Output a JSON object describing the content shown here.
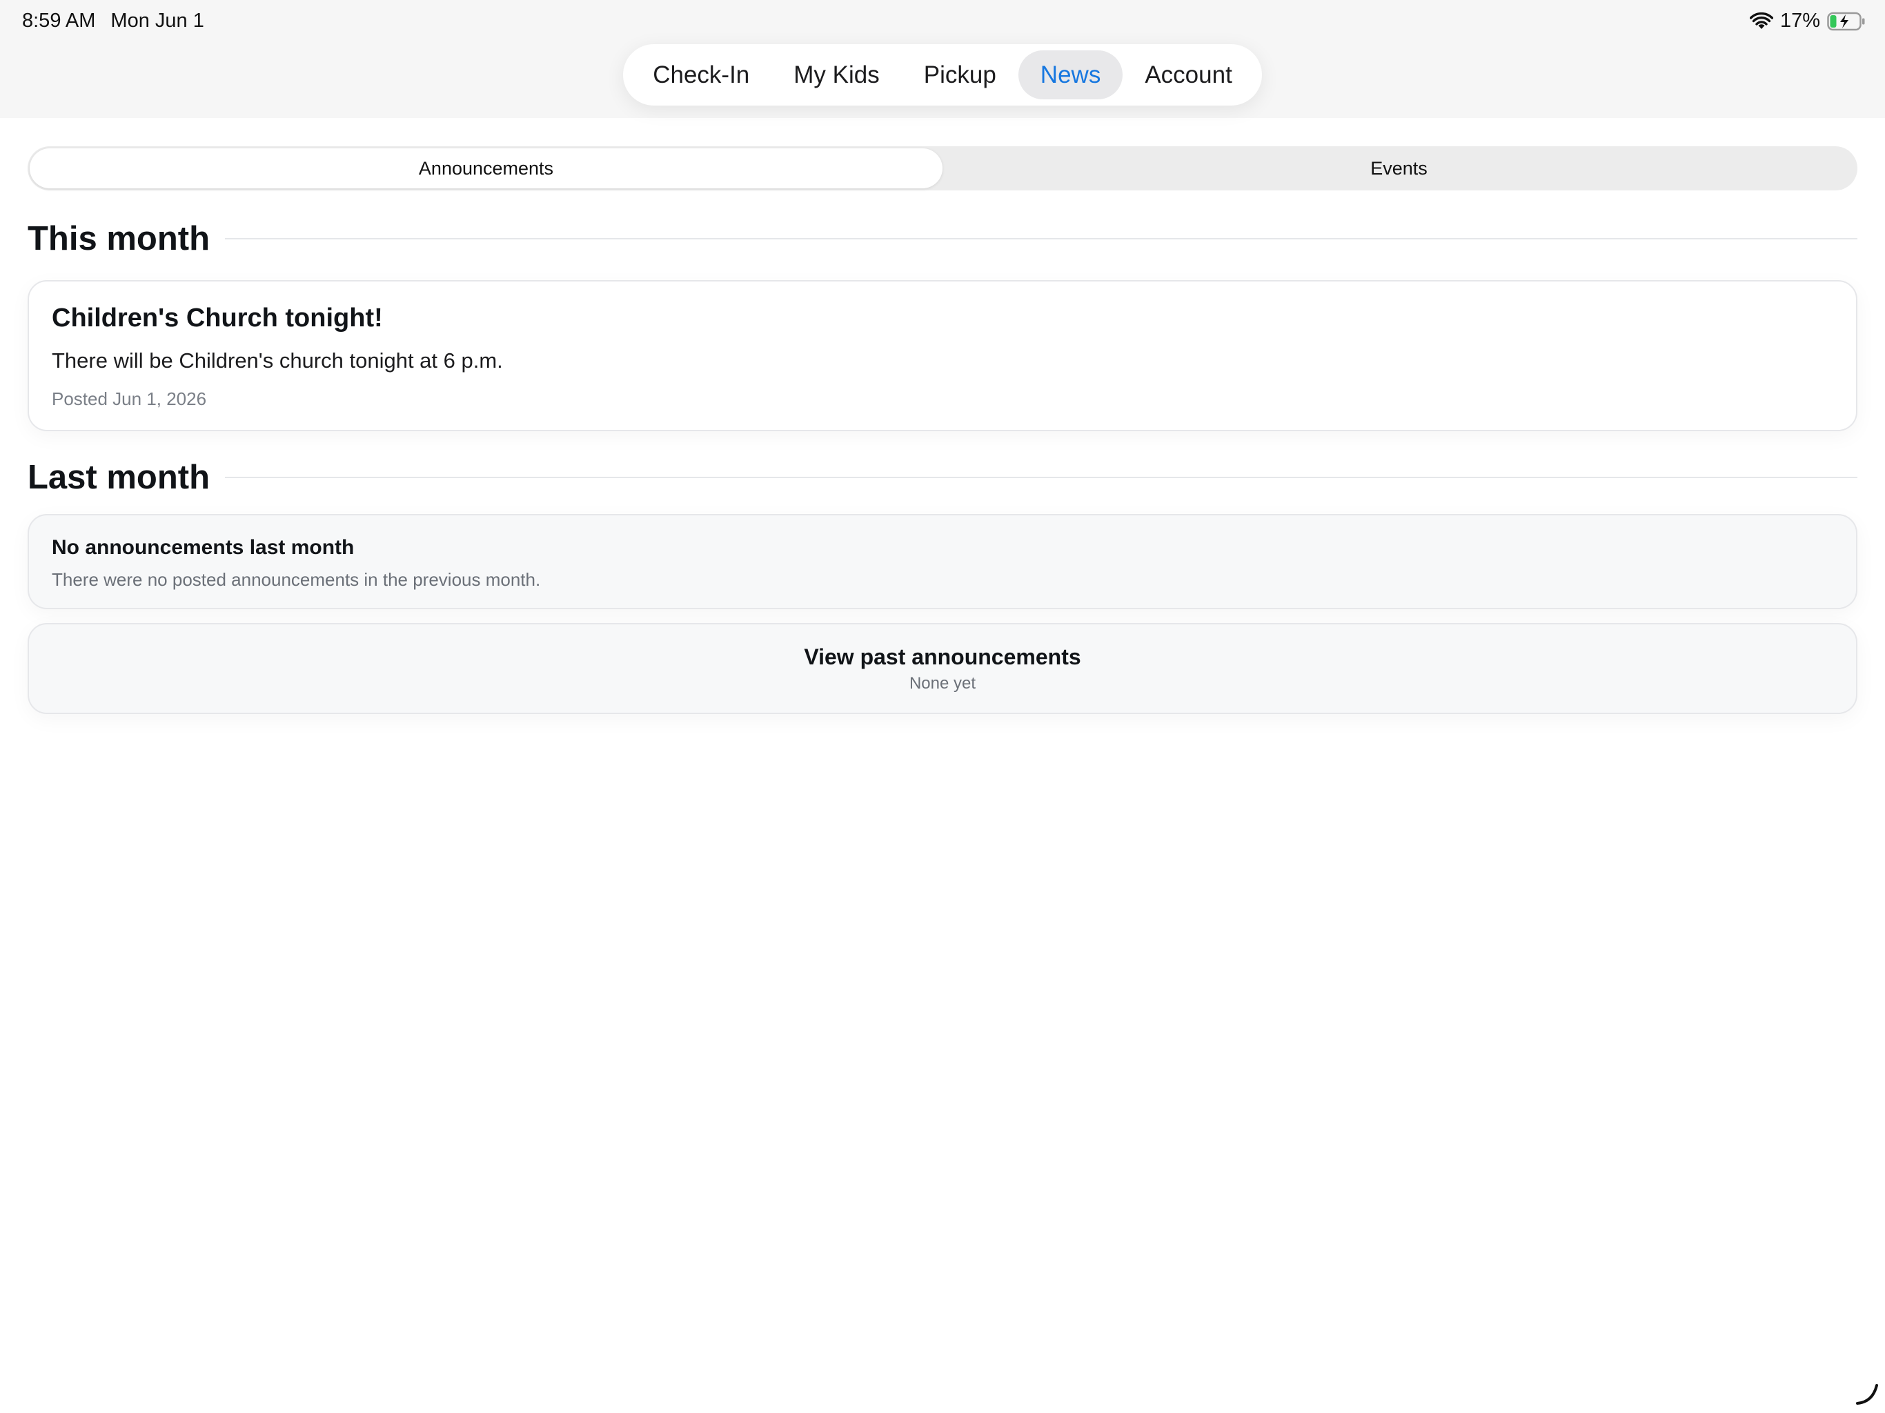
{
  "status_bar": {
    "time": "8:59 AM",
    "date": "Mon Jun 1",
    "battery": "17%",
    "icons": [
      "wifi-icon",
      "battery-charging-icon"
    ]
  },
  "tabs": [
    {
      "label": "Check-In",
      "active": false
    },
    {
      "label": "My Kids",
      "active": false
    },
    {
      "label": "Pickup",
      "active": false
    },
    {
      "label": "News",
      "active": true
    },
    {
      "label": "Account",
      "active": false
    }
  ],
  "segmented": {
    "items": [
      "Announcements",
      "Events"
    ],
    "selected": "Announcements"
  },
  "sections": {
    "this_month": {
      "heading": "This month",
      "announcement": {
        "title": "Children's Church tonight!",
        "body": "There will be Children's church tonight at 6 p.m.",
        "posted": "Posted Jun 1, 2026"
      }
    },
    "last_month": {
      "heading": "Last month",
      "empty_title": "No announcements last month",
      "empty_text": "There were no posted announcements in the previous month."
    }
  },
  "past": {
    "title": "View past announcements",
    "subtitle": "None yet"
  },
  "colors": {
    "accent": "#1677e0",
    "battery_green": "#34c759"
  }
}
